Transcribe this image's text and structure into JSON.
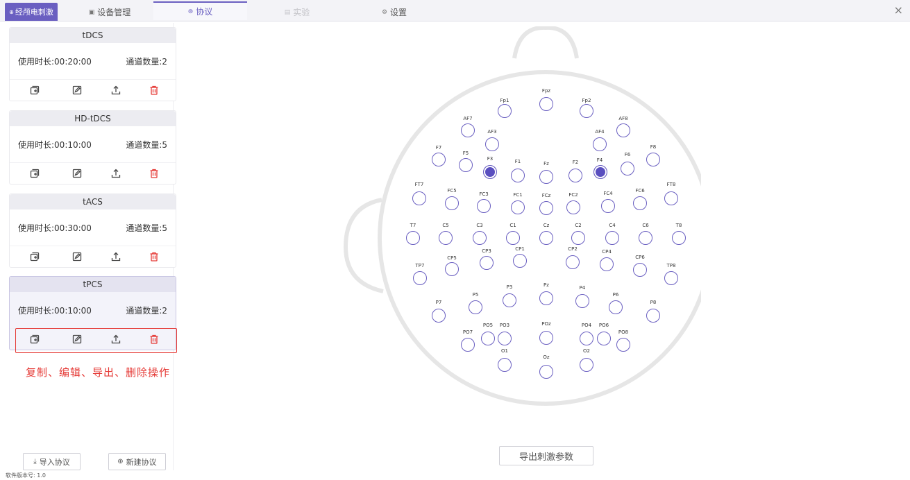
{
  "topbar": {
    "brand_label": "经颅电刺激",
    "tabs": [
      {
        "label": "设备管理",
        "icon": "device-icon"
      },
      {
        "label": "协议",
        "icon": "protocol-icon"
      },
      {
        "label": "实验",
        "icon": "experiment-icon"
      },
      {
        "label": "设置",
        "icon": "settings-icon"
      }
    ],
    "close_label": "×"
  },
  "protocols": [
    {
      "title": "tDCS",
      "duration": "使用时长:00:20:00",
      "channels": "通道数量:2"
    },
    {
      "title": "HD-tDCS",
      "duration": "使用时长:00:10:00",
      "channels": "通道数量:5"
    },
    {
      "title": "tACS",
      "duration": "使用时长:00:30:00",
      "channels": "通道数量:5"
    },
    {
      "title": "tPCS",
      "duration": "使用时长:00:10:00",
      "channels": "通道数量:2"
    }
  ],
  "annotation": "复制、编辑、导出、删除操作",
  "buttons": {
    "import": "导入协议",
    "new": "新建协议",
    "export_params": "导出刺激参数"
  },
  "version": "软件版本号: 1.0",
  "colors": {
    "accent": "#6a5fc1",
    "delete": "#e53935",
    "selected_electrode": "#5a4fbf"
  },
  "electrodes": [
    {
      "name": "Fpz",
      "active": false
    },
    {
      "name": "Fp1",
      "active": false
    },
    {
      "name": "Fp2",
      "active": false
    },
    {
      "name": "AF7",
      "active": false
    },
    {
      "name": "AF8",
      "active": false
    },
    {
      "name": "AF3",
      "active": false
    },
    {
      "name": "AF4",
      "active": false
    },
    {
      "name": "F7",
      "active": false
    },
    {
      "name": "F5",
      "active": false
    },
    {
      "name": "F3",
      "active": true
    },
    {
      "name": "F1",
      "active": false
    },
    {
      "name": "Fz",
      "active": false
    },
    {
      "name": "F2",
      "active": false
    },
    {
      "name": "F4",
      "active": true
    },
    {
      "name": "F6",
      "active": false
    },
    {
      "name": "F8",
      "active": false
    },
    {
      "name": "FT7",
      "active": false
    },
    {
      "name": "FC5",
      "active": false
    },
    {
      "name": "FC3",
      "active": false
    },
    {
      "name": "FC1",
      "active": false
    },
    {
      "name": "FCz",
      "active": false
    },
    {
      "name": "FC2",
      "active": false
    },
    {
      "name": "FC4",
      "active": false
    },
    {
      "name": "FC6",
      "active": false
    },
    {
      "name": "FT8",
      "active": false
    },
    {
      "name": "T7",
      "active": false
    },
    {
      "name": "C5",
      "active": false
    },
    {
      "name": "C3",
      "active": false
    },
    {
      "name": "C1",
      "active": false
    },
    {
      "name": "Cz",
      "active": false
    },
    {
      "name": "C2",
      "active": false
    },
    {
      "name": "C4",
      "active": false
    },
    {
      "name": "C6",
      "active": false
    },
    {
      "name": "T8",
      "active": false
    },
    {
      "name": "TP7",
      "active": false
    },
    {
      "name": "CP5",
      "active": false
    },
    {
      "name": "CP3",
      "active": false
    },
    {
      "name": "CP1",
      "active": false
    },
    {
      "name": "CP2",
      "active": false
    },
    {
      "name": "CP4",
      "active": false
    },
    {
      "name": "CP6",
      "active": false
    },
    {
      "name": "TP8",
      "active": false
    },
    {
      "name": "P7",
      "active": false
    },
    {
      "name": "P5",
      "active": false
    },
    {
      "name": "P3",
      "active": false
    },
    {
      "name": "Pz",
      "active": false
    },
    {
      "name": "P4",
      "active": false
    },
    {
      "name": "P6",
      "active": false
    },
    {
      "name": "P8",
      "active": false
    },
    {
      "name": "PO7",
      "active": false
    },
    {
      "name": "PO5",
      "active": false
    },
    {
      "name": "PO3",
      "active": false
    },
    {
      "name": "POz",
      "active": false
    },
    {
      "name": "PO4",
      "active": false
    },
    {
      "name": "PO6",
      "active": false
    },
    {
      "name": "PO8",
      "active": false
    },
    {
      "name": "O1",
      "active": false
    },
    {
      "name": "Oz",
      "active": false
    },
    {
      "name": "O2",
      "active": false
    }
  ]
}
